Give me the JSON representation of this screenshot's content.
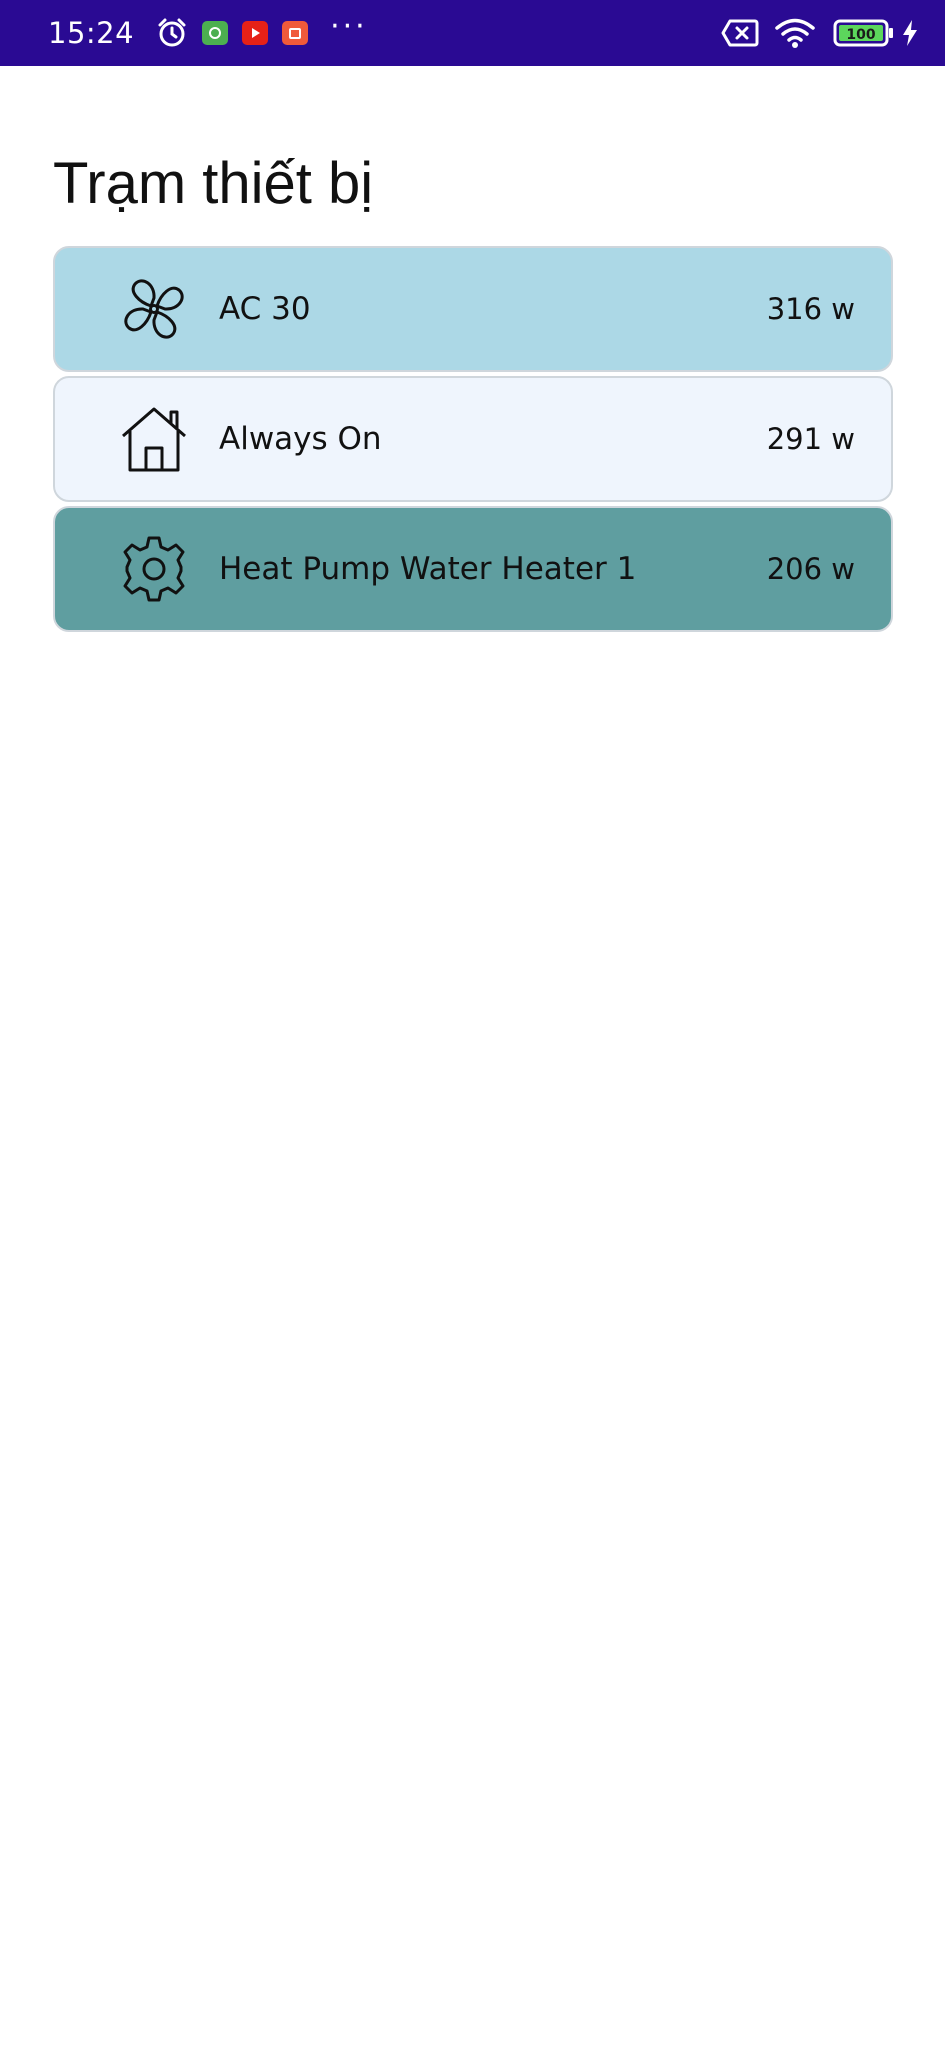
{
  "status_bar": {
    "time": "15:24",
    "battery": "100",
    "icons": [
      "alarm-icon",
      "app-green-icon",
      "youtube-icon",
      "app-orange-icon",
      "more-dots-icon",
      "no-sim-icon",
      "wifi-icon",
      "battery-icon",
      "charging-icon"
    ],
    "background": "#2a0a93"
  },
  "page": {
    "title": "Trạm thiết bị"
  },
  "devices": [
    {
      "name": "AC 30",
      "power": "316 w",
      "icon": "fan-icon",
      "color": "#acd8e6"
    },
    {
      "name": "Always On",
      "power": "291 w",
      "icon": "house-icon",
      "color": "#eff5fd"
    },
    {
      "name": "Heat Pump Water Heater 1",
      "power": "206 w",
      "icon": "gear-icon",
      "color": "#5f9ea0"
    }
  ]
}
